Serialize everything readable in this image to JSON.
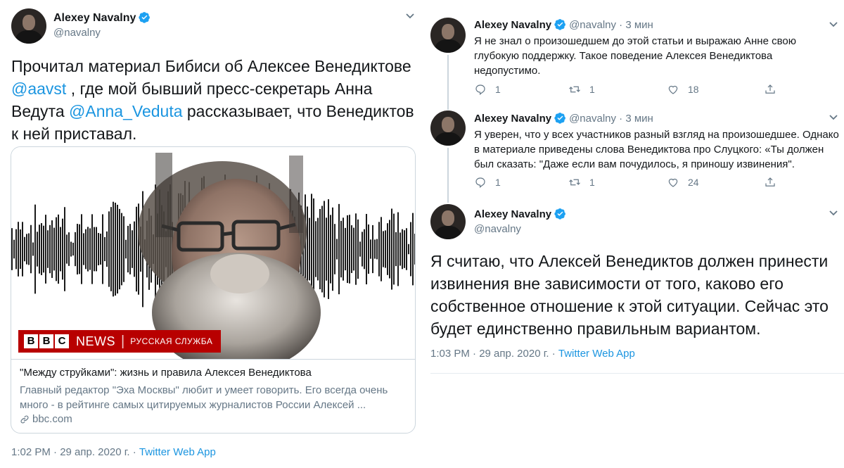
{
  "left_tweet": {
    "author_name": "Alexey Navalny",
    "handle": "@navalny",
    "text_parts": [
      "Прочитал материал Бибиси об Алексее Венедиктове ",
      "@aavst",
      " , где мой бывший пресс-секретарь Анна Ведута ",
      "@Anna_Veduta",
      "  рассказывает, что Венедиктов к ней приставал."
    ],
    "card": {
      "brand_box": [
        "B",
        "B",
        "C"
      ],
      "brand_news": "NEWS",
      "brand_sep": "|",
      "brand_service": "РУССКАЯ СЛУЖБА",
      "title": "\"Между струйками\": жизнь и правила Алексея Венедиктова",
      "description": "Главный редактор \"Эха Москвы\" любит и умеет говорить. Его всегда очень много - в рейтинге самых цитируемых журналистов России Алексей ...",
      "domain": "bbc.com"
    },
    "timestamp": "1:02 PM · 29 апр. 2020 г. · ",
    "source_app": "Twitter Web App"
  },
  "right_thread": {
    "replies": [
      {
        "author_name": "Alexey Navalny",
        "handle": "@navalny · 3 мин",
        "text": "Я не знал о произошедшем до этой статьи и выражаю Анне свою глубокую поддержку. Такое поведение Алексея Венедиктова недопустимо.",
        "reply_count": "1",
        "retweet_count": "1",
        "like_count": "18"
      },
      {
        "author_name": "Alexey Navalny",
        "handle": "@navalny · 3 мин",
        "text": "Я уверен, что у всех участников разный взгляд на произошедшее. Однако в материале приведены слова Венедиктова про Слуцкого: «Ты должен был сказать: \"Даже если вам почудилось, я приношу извинения\".",
        "reply_count": "1",
        "retweet_count": "1",
        "like_count": "24"
      }
    ],
    "main": {
      "author_name": "Alexey Navalny",
      "handle": "@navalny",
      "text": "Я считаю, что Алексей Венедиктов должен принести извинения вне зависимости от того, каково его собственное отношение к этой ситуации. Сейчас это будет единственно правильным вариантом.",
      "timestamp": "1:03 PM · 29 апр. 2020 г. · ",
      "source_app": "Twitter Web App"
    }
  },
  "icons": [
    "verified-badge-icon",
    "chevron-down-icon",
    "reply-icon",
    "retweet-icon",
    "like-icon",
    "share-icon",
    "link-icon"
  ],
  "colors": {
    "accent": "#1b95e0",
    "muted": "#657786",
    "text": "#14171a",
    "bbc_red": "#b80000"
  }
}
